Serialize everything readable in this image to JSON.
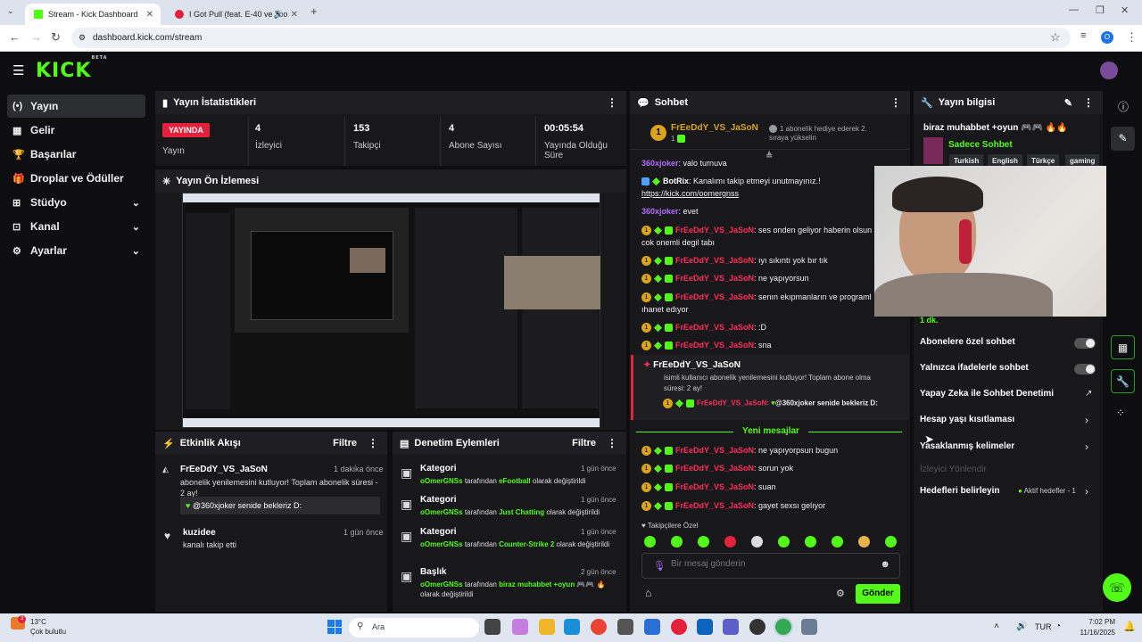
{
  "browser": {
    "tabs": [
      {
        "title": "Stream - Kick Dashboard"
      },
      {
        "title": "I Got Pull (feat. E-40 ve Too"
      }
    ],
    "url": "dashboard.kick.com/stream",
    "profile_initial": "O"
  },
  "app": {
    "logo": "KICK",
    "logo_sup": "BETA"
  },
  "sidebar": {
    "items": [
      {
        "icon": "(•)",
        "label": "Yayın"
      },
      {
        "icon": "▦",
        "label": "Gelir"
      },
      {
        "icon": "🏆",
        "label": "Başarılar"
      },
      {
        "icon": "🎁",
        "label": "Droplar ve Ödüller"
      },
      {
        "icon": "⊞",
        "label": "Stüdyo"
      },
      {
        "icon": "⊡",
        "label": "Kanal"
      },
      {
        "icon": "⚙",
        "label": "Ayarlar"
      }
    ]
  },
  "stats": {
    "title": "Yayın İstatistikleri",
    "live_badge": "YAYINDA",
    "live_label": "Yayın",
    "viewers_value": "4",
    "viewers_label": "İzleyici",
    "followers_value": "153",
    "followers_label": "Takipçi",
    "subs_value": "4",
    "subs_label": "Abone Sayısı",
    "duration_value": "00:05:54",
    "duration_label": "Yayında Olduğu Süre"
  },
  "preview": {
    "title": "Yayın Ön İzlemesi"
  },
  "activity": {
    "title": "Etkinlik Akışı",
    "filter": "Filtre",
    "items": [
      {
        "user": "FrEeDdY_VS_JaSoN",
        "time": "1 dakika önce",
        "text": "abonelik yenilemesini kutluyor! Toplam abonelik süresi - 2 ay!",
        "message": "@360xjoker senide bekleriz D:"
      },
      {
        "user": "kuzidee",
        "time": "1 gün önce",
        "text": "kanalı takip etti"
      }
    ]
  },
  "moderation": {
    "title": "Denetim Eylemleri",
    "filter": "Filtre",
    "items": [
      {
        "title": "Kategori",
        "time": "1 gün önce",
        "user": "oOmerGNSs",
        "mid": "tarafından",
        "value": "eFootball",
        "end": "olarak değiştirildi"
      },
      {
        "title": "Kategori",
        "time": "1 gün önce",
        "user": "oOmerGNSs",
        "mid": "tarafından",
        "value": "Just Chatting",
        "end": "olarak değiştirildi"
      },
      {
        "title": "Kategori",
        "time": "1 gün önce",
        "user": "oOmerGNSs",
        "mid": "tarafından",
        "value": "Counter-Strike 2",
        "end": "olarak değiştirildi"
      },
      {
        "title": "Başlık",
        "time": "2 gün önce",
        "user": "oOmerGNSs",
        "mid": "tarafından",
        "value": "biraz muhabbet +oyun 🎮🎮 🔥",
        "end": "olarak değiştirildi"
      }
    ]
  },
  "chat": {
    "title": "Sohbet",
    "pinned_user": "FrEeDdY_VS_JaSoN",
    "pinned_rank": "1",
    "pinned_note": "1 abonelik hediye ederek 2. sıraya yükselin",
    "messages": [
      {
        "user": "360xjoker",
        "text": ": valo turnuva"
      },
      {
        "user": "BotRix",
        "text": ": Kanalımı takip etmeyi unutmayınız.!"
      },
      {
        "user": "",
        "text": "https://kick.com/oomergnss"
      },
      {
        "user": "360xjoker",
        "text": ": evet"
      },
      {
        "user": "FrEeDdY_VS_JaSoN",
        "text": ": ses onden geliyor haberin olsun"
      },
      {
        "user": "",
        "text": "cok onemli degil tabı"
      },
      {
        "user": "FrEeDdY_VS_JaSoN",
        "text": ": ıyı sıkıntı yok bır tık"
      },
      {
        "user": "FrEeDdY_VS_JaSoN",
        "text": ": ne yapıyorsun"
      },
      {
        "user": "FrEeDdY_VS_JaSoN",
        "text": ": senın ekıpmanların ve programl"
      },
      {
        "user": "",
        "text": "ıhanet edıyor"
      },
      {
        "user": "FrEeDdY_VS_JaSoN",
        "text": ": :D"
      },
      {
        "user": "FrEeDdY_VS_JaSoN",
        "text": ": sna"
      }
    ],
    "resub": {
      "user": "FrEeDdY_VS_JaSoN",
      "text1": "isimli kullanıcı abonelik yenilemesini kutluyor! Toplam abone olma",
      "text2": "süresi: 2 ay!",
      "msg_user": "FrEeDdY_VS_JaSoN:",
      "msg": "@360xjoker senide bekleriz D:"
    },
    "new_divider": "Yeni mesajlar",
    "new_messages": [
      {
        "user": "FrEeDdY_VS_JaSoN",
        "text": ": ne yapıyorpsun bugun"
      },
      {
        "user": "FrEeDdY_VS_JaSoN",
        "text": ": sorun yok"
      },
      {
        "user": "FrEeDdY_VS_JaSoN",
        "text": ": suan"
      },
      {
        "user": "FrEeDdY_VS_JaSoN",
        "text": ": gayet sexsı gelıyor"
      }
    ],
    "followers_only": "Takipçilere Özel",
    "placeholder": "Bir mesaj gönderin",
    "send": "Gönder"
  },
  "info": {
    "title": "Yayın bilgisi",
    "stream_title": "biraz muhabbet +oyun 🎮🎮 🔥🔥",
    "category": "Sadece Sohbet",
    "tags": [
      "Turkish",
      "English",
      "Türkçe",
      "gaming"
    ],
    "slow_value": "1 dk.",
    "settings": [
      {
        "label": "Abonelere özel sohbet"
      },
      {
        "label": "Yalnızca ifadelerle sohbet"
      },
      {
        "label": "Yapay Zeka ile Sohbet Denetimi"
      },
      {
        "label": "Hesap yaşı kısıtlaması"
      },
      {
        "label": "Yasaklanmış kelimeler"
      },
      {
        "label": "İzleyici Yönlendir"
      },
      {
        "label": "Hedefleri belirleyin"
      }
    ],
    "goals_status": "Aktif hedefler - 1"
  },
  "taskbar": {
    "temp": "13°C",
    "weather": "Çok bulutlu",
    "search": "Ara",
    "lang": "TUR",
    "time": "7:02 PM",
    "date": "11/16/2025",
    "weather_badge": "3"
  }
}
